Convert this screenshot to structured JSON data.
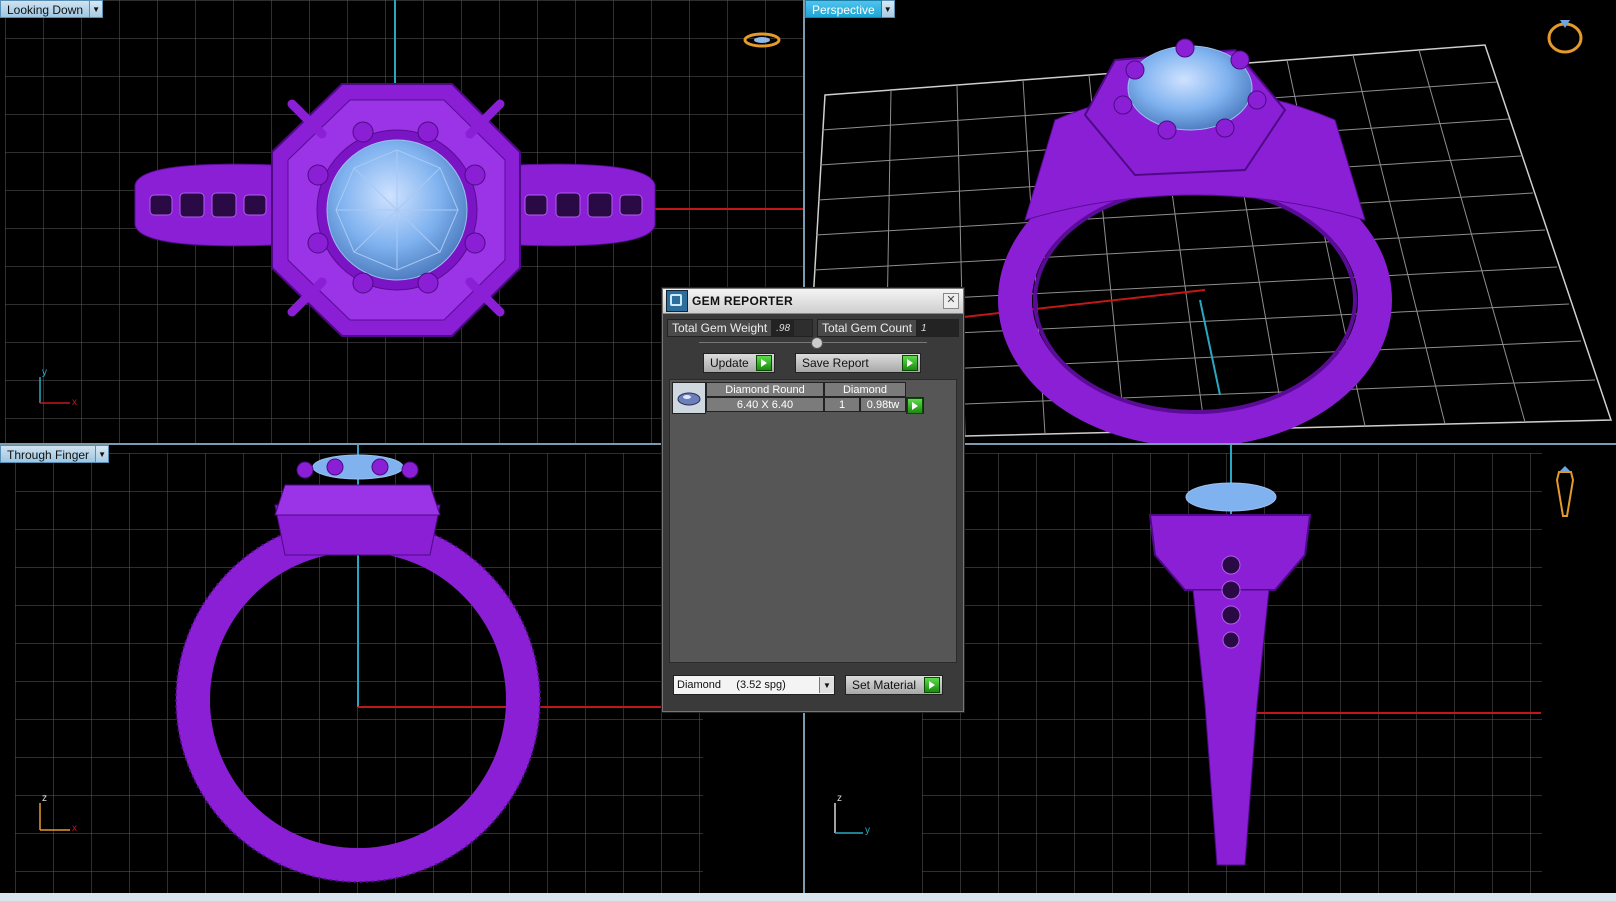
{
  "viewports": {
    "top_left": {
      "label": "Looking Down"
    },
    "top_right": {
      "label": "Perspective"
    },
    "bottom_left": {
      "label": "Through Finger"
    },
    "bottom_right": {
      "label": ""
    }
  },
  "axes": {
    "top_left": {
      "a": "y",
      "b": "x"
    },
    "bottom_left": {
      "a": "z",
      "b": "x"
    },
    "bottom_right": {
      "a": "z",
      "b": "y"
    }
  },
  "gem_reporter": {
    "title": "GEM REPORTER",
    "close": "✕",
    "total_gem_weight_label": "Total Gem Weight",
    "total_gem_weight_value": ".98",
    "total_gem_count_label": "Total Gem Count",
    "total_gem_count_value": "1",
    "update_label": "Update",
    "save_report_label": "Save Report",
    "gems": [
      {
        "name": "Diamond Round",
        "material": "Diamond",
        "size": "6.40 X 6.40",
        "count": "1",
        "weight": "0.98tw"
      }
    ],
    "material_select": "Diamond     (3.52 spg)",
    "set_material_label": "Set Material"
  },
  "colors": {
    "metal": "#8a1fd6",
    "gem": "#7fb2ef",
    "grid": "#606060",
    "axis_red": "#c01818",
    "axis_cyan": "#2aa7c2"
  }
}
